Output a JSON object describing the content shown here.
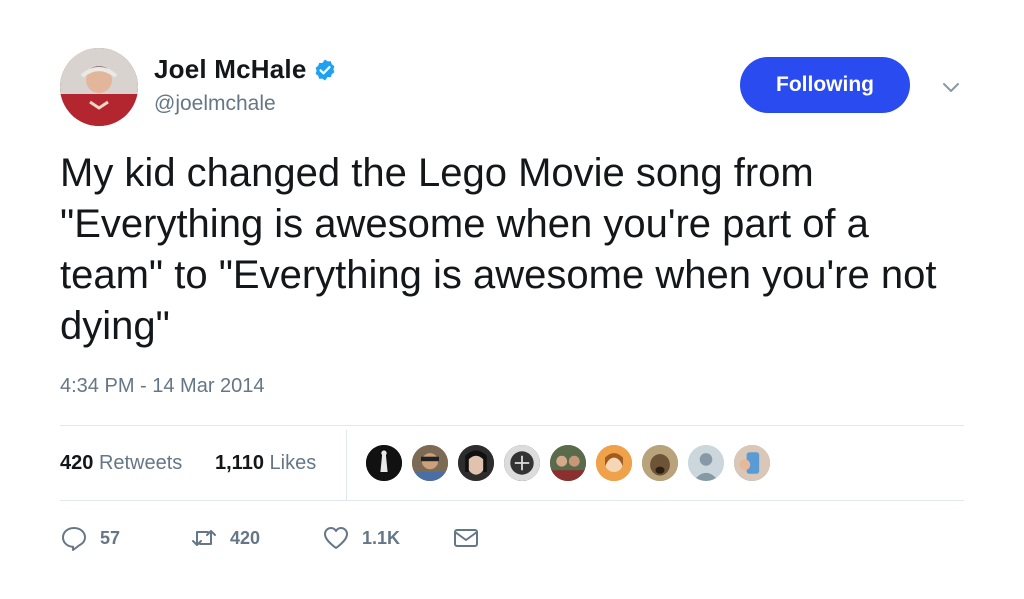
{
  "tweet": {
    "author": {
      "name": "Joel McHale",
      "handle": "@joelmchale",
      "verified": true
    },
    "follow_button_label": "Following",
    "text": "My kid changed the Lego Movie song from \"Everything is awesome when you're part of a team\" to \"Everything is awesome when you're not dying\"",
    "timestamp": "4:34 PM - 14 Mar 2014",
    "stats": {
      "retweets_count": "420",
      "retweets_label": "Retweets",
      "likes_count": "1,110",
      "likes_label": "Likes"
    },
    "actions": {
      "reply_count": "57",
      "retweet_count": "420",
      "like_count": "1.1K"
    }
  },
  "colors": {
    "accent": "#2a4bf0",
    "verified": "#1da1f2",
    "muted_text": "#657786"
  },
  "icons": [
    "verified-badge-icon",
    "chevron-down-icon",
    "reply-icon",
    "retweet-icon",
    "heart-icon",
    "message-icon"
  ]
}
